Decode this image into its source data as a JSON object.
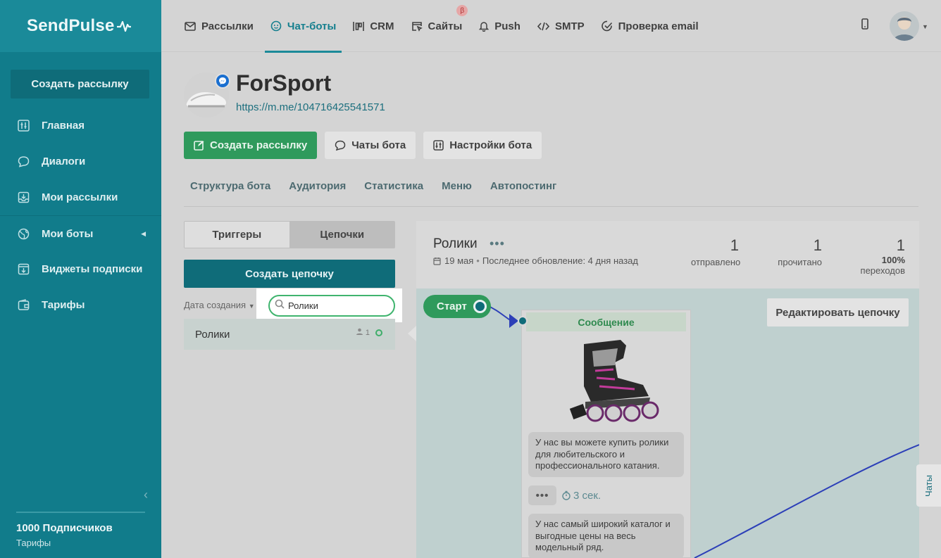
{
  "logo": {
    "text": "SendPulse"
  },
  "sidebar": {
    "create_button": "Создать рассылку",
    "items": [
      {
        "label": "Главная",
        "icon": "dashboard-icon"
      },
      {
        "label": "Диалоги",
        "icon": "chat-bubble-icon"
      },
      {
        "label": "Мои рассылки",
        "icon": "inbox-icon"
      },
      {
        "label": "Мои боты",
        "icon": "globe-icon"
      },
      {
        "label": "Виджеты подписки",
        "icon": "widget-icon"
      },
      {
        "label": "Тарифы",
        "icon": "wallet-icon"
      }
    ],
    "subscribers": "1000 Подписчиков",
    "plan_link": "Тарифы"
  },
  "topnav": {
    "tabs": [
      {
        "label": "Рассылки",
        "icon": "envelope-icon"
      },
      {
        "label": "Чат-боты",
        "icon": "bot-icon"
      },
      {
        "label": "CRM",
        "icon": "kanban-icon"
      },
      {
        "label": "Сайты",
        "icon": "site-icon"
      },
      {
        "label": "Push",
        "icon": "bell-icon"
      },
      {
        "label": "SMTP",
        "icon": "code-icon"
      },
      {
        "label": "Проверка email",
        "icon": "check-circle-icon"
      }
    ],
    "beta_badge": "β"
  },
  "bot": {
    "name": "ForSport",
    "link": "https://m.me/104716425541571",
    "buttons": {
      "create": "Создать рассылку",
      "chats": "Чаты бота",
      "settings": "Настройки бота"
    },
    "subtabs": [
      "Структура бота",
      "Аудитория",
      "Статистика",
      "Меню",
      "Автопостинг"
    ]
  },
  "left": {
    "seg_triggers": "Триггеры",
    "seg_chains": "Цепочки",
    "create_chain": "Создать цепочку",
    "sort_label": "Дата создания",
    "search_value": "Ролики",
    "chain_row": {
      "name": "Ролики",
      "count": "1"
    }
  },
  "chain": {
    "title": "Ролики",
    "date": "19 мая",
    "updated": "Последнее обновление: 4 дня назад",
    "stats": {
      "sent_num": "1",
      "sent_lbl": "отправлено",
      "read_num": "1",
      "read_lbl": "прочитано",
      "click_num": "1",
      "click_pct": "100%",
      "click_lbl": "переходов"
    },
    "start": "Старт",
    "edit_button": "Редактировать цепочку",
    "card": {
      "header": "Сообщение",
      "text1": "У нас вы можете купить ролики для любительского и профессионального катания.",
      "delay": "3 сек.",
      "text2": "У нас самый широкий каталог и выгодные цены на весь модельный ряд."
    },
    "chats_tab": "Чаты"
  }
}
